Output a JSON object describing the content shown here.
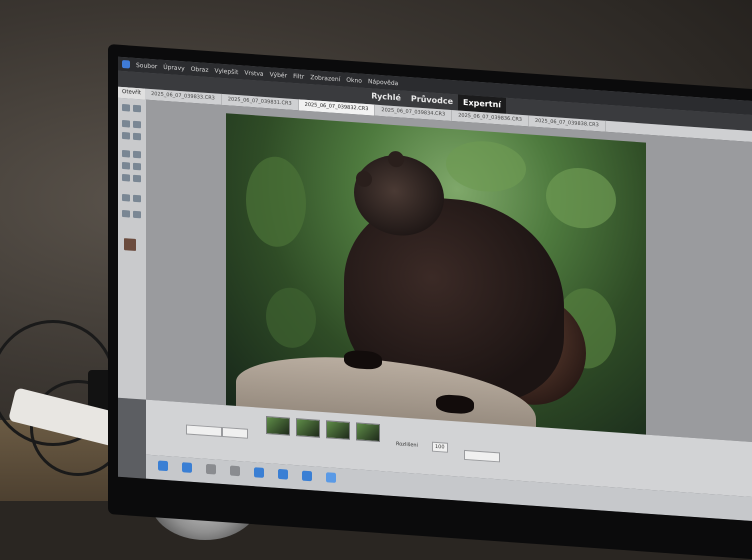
{
  "menu": {
    "items": [
      "Soubor",
      "Úpravy",
      "Obraz",
      "Vylepšit",
      "Vrstva",
      "Výběr",
      "Filtr",
      "Zobrazení",
      "Okno",
      "Nápověda"
    ]
  },
  "modes": {
    "items": [
      {
        "label": "Rychlé",
        "active": false
      },
      {
        "label": "Průvodce",
        "active": false
      },
      {
        "label": "Expertní",
        "active": true
      }
    ]
  },
  "tabs": {
    "open_label": "Otevřít",
    "items": [
      {
        "label": "2025_06_07_039833.CR3",
        "active": false
      },
      {
        "label": "2025_06_07_039831.CR3",
        "active": false
      },
      {
        "label": "2025_06_07_039832.CR3",
        "active": true
      },
      {
        "label": "2025_06_07_039834.CR3",
        "active": false
      },
      {
        "label": "2025_06_07_039836.CR3",
        "active": false
      },
      {
        "label": "2025_06_07_039838.CR3",
        "active": false
      }
    ]
  },
  "bottom_panel": {
    "zoom_value": "100",
    "label": "Rozlišení"
  },
  "colors": {
    "accent": "#3f7bd6",
    "active_mode_bg": "#1b1b1c"
  }
}
